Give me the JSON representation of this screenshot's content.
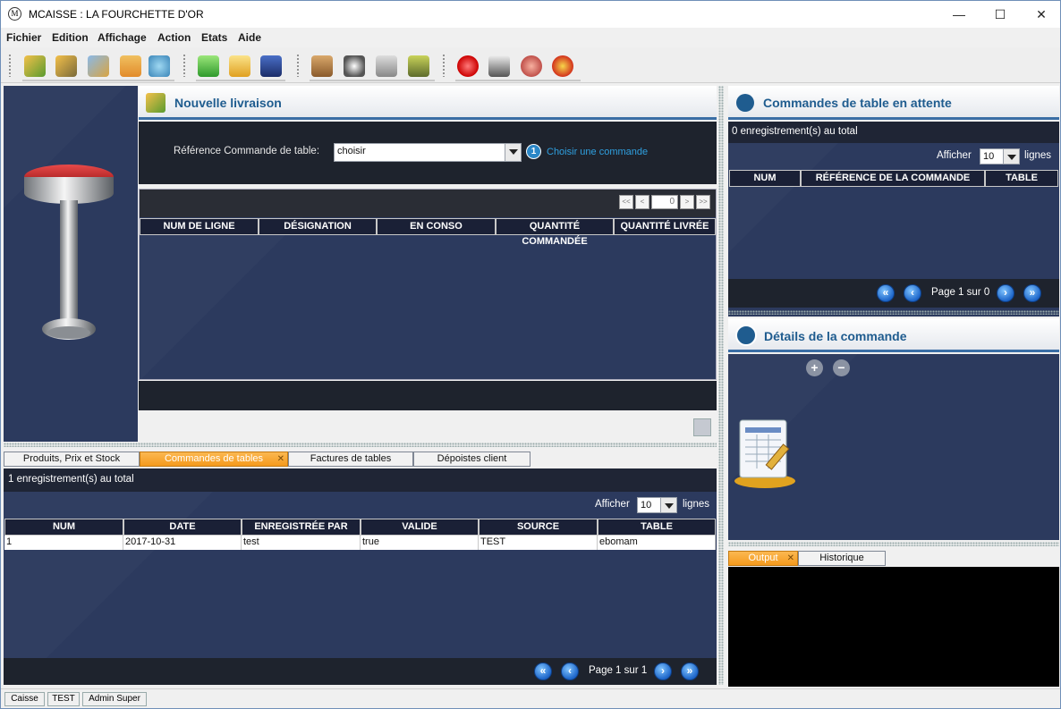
{
  "window": {
    "title": "MCAISSE : LA FOURCHETTE D'OR",
    "logo_letter": "M"
  },
  "window_controls": {
    "minimize": "—",
    "maximize": "☐",
    "close": "✕"
  },
  "menu": [
    "Fichier",
    "Edition",
    "Affichage",
    "Action",
    "Etats",
    "Aide"
  ],
  "toolbar": {
    "icons": [
      "cart-add-icon",
      "cart-icon",
      "cart-transfer-icon",
      "user-icon",
      "refresh-icon",
      "cash-icon",
      "invoice-icon",
      "delivery-icon",
      "deliveryman-icon",
      "stopwatch-icon",
      "key-icon",
      "cash-register-icon",
      "cancel-icon",
      "printer-icon",
      "piggy-bank-icon",
      "settings-icon"
    ]
  },
  "colors": {
    "accent": "#1f5c8f",
    "panel_dark": "#2c3a5e",
    "tab_active": "#f59a1d"
  },
  "livraison": {
    "title": "Nouvelle livraison",
    "ref_label": "Référence Commande de table:",
    "ref_select_value": "choisir",
    "step_number": "1",
    "step_text": "Choisir une commande",
    "pager_first": "<<",
    "pager_prev": "<",
    "pager_value": "0",
    "pager_next": ">",
    "pager_last": ">>",
    "columns": [
      "NUM DE LIGNE",
      "DÉSIGNATION",
      "EN CONSO",
      "QUANTITÉ COMMANDÉE",
      "QUANTITÉ LIVRÉE"
    ]
  },
  "bottom_tabs": {
    "tabs": [
      "Produits, Prix et Stock",
      "Commandes de tables",
      "Factures de tables",
      "Dépoistes client"
    ],
    "active": 1,
    "close_glyph": "✕"
  },
  "commandes_tables": {
    "total_text": "1 enregistrement(s) au total",
    "afficher_label": "Afficher",
    "rows_per_page": "10",
    "lignes_label": "lignes",
    "columns": [
      "NUM",
      "DATE",
      "ENREGISTRÉE PAR",
      "VALIDE",
      "SOURCE",
      "TABLE"
    ],
    "rows": [
      [
        "1",
        "2017-10-31",
        "test",
        "true",
        "TEST",
        "ebomam"
      ]
    ],
    "page_text": "Page 1 sur 1"
  },
  "attente": {
    "title": "Commandes de table en attente",
    "total_text": "0 enregistrement(s) au total",
    "afficher_label": "Afficher",
    "rows_per_page": "10",
    "lignes_label": "lignes",
    "columns": [
      "NUM",
      "RÉFÉRENCE DE LA COMMANDE",
      "TABLE"
    ],
    "page_text": "Page 1 sur 0"
  },
  "details": {
    "title": "Détails de la commande",
    "add": "+",
    "remove": "−"
  },
  "output_tabs": {
    "tabs": [
      "Output",
      "Historique"
    ],
    "active": 0,
    "close_glyph": "✕"
  },
  "statusbar": [
    "Caisse",
    "TEST",
    "Admin Super"
  ],
  "nav": {
    "first": "«",
    "prev": "‹",
    "next": "›",
    "last": "»"
  }
}
